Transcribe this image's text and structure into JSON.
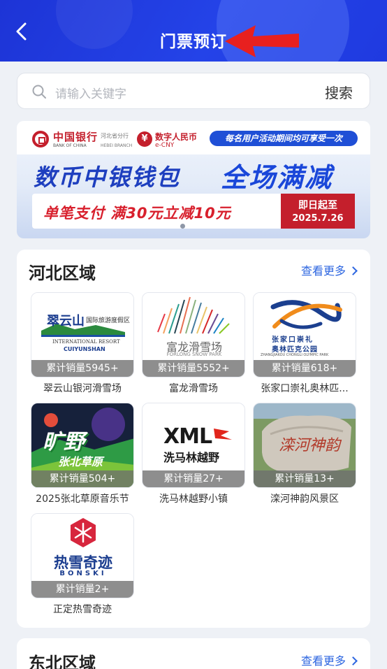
{
  "header": {
    "title": "门票预订",
    "back_icon": "chevron-left-icon",
    "annotation_icon": "red-arrow-icon",
    "color": "#2443e8"
  },
  "search": {
    "placeholder": "请输入关键字",
    "button_label": "搜索"
  },
  "banner": {
    "bank_name": "中国银行",
    "bank_name_en": "BANK OF CHINA",
    "branch": "河北省分行",
    "branch_en": "HEBEI BRANCH",
    "ecny_name": "数字人民币",
    "ecny_en": "e-CNY",
    "promo_tag": "每名用户活动期间均可享受一次",
    "headline_left": "数币中银钱包",
    "headline_right": "全场满减",
    "offer": "单笔支付 满30元立减10元",
    "date_label": "即日起至",
    "date_value": "2025.7.26",
    "accent": "#c41f2c"
  },
  "sections": [
    {
      "title": "河北区域",
      "more_label": "查看更多",
      "items": [
        {
          "name": "翠云山银河滑雪场",
          "sales": "累计销量5945+",
          "logo_text": "翠云山",
          "logo_sub": "国际旅游度假区",
          "logo_en1": "INTERNATIONAL RESORT",
          "logo_en2": "CUIYUNSHAN"
        },
        {
          "name": "富龙滑雪场",
          "sales": "累计销量5552+",
          "logo_text": "富龙滑雪场",
          "logo_en": "FORLONG SNOW PARK"
        },
        {
          "name": "张家口崇礼奥林匹...",
          "sales": "累计销量618+",
          "logo_text1": "张家口崇礼",
          "logo_text2": "奥林匹克公园",
          "logo_en": "ZHANGJIAKOU CHONGLI OLYMPIC PARK"
        },
        {
          "name": "2025张北草原音乐节",
          "sales": "累计销量504+",
          "logo_text1": "旷野",
          "logo_text2": "张北草原"
        },
        {
          "name": "洗马林越野小镇",
          "sales": "累计销量27+",
          "logo_text1": "XML",
          "logo_text2": "洗马林越野"
        },
        {
          "name": "滦河神韵风景区",
          "sales": "累计销量13+",
          "logo_text": "滦河神韵"
        },
        {
          "name": "正定热雪奇迹",
          "sales": "累计销量2+",
          "logo_text1": "热雪奇迹",
          "logo_text2": "BONSKI"
        }
      ]
    },
    {
      "title": "东北区域",
      "more_label": "查看更多"
    }
  ]
}
